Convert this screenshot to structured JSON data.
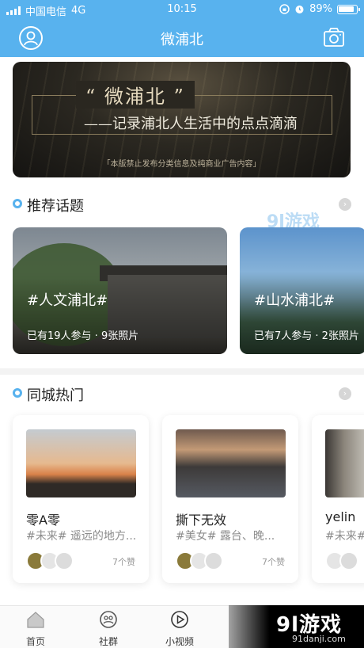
{
  "status_bar": {
    "carrier": "中国电信",
    "network": "4G",
    "time": "10:15",
    "battery": "89%"
  },
  "header": {
    "title": "微浦北"
  },
  "banner": {
    "title": "“ 微浦北 ”",
    "subtitle": "——记录浦北人生活中的点点滴滴",
    "notice": "「本版禁止发布分类信息及纯商业广告内容」"
  },
  "recommended": {
    "heading": "推荐话题",
    "topics": [
      {
        "tag": "#人文浦北#",
        "info": "已有19人参与 · 9张照片"
      },
      {
        "tag": "#山水浦北#",
        "info": "已有7人参与 · 2张照片"
      }
    ]
  },
  "hot": {
    "heading": "同城热门",
    "cards": [
      {
        "name": "零A零",
        "desc": "#未来# 遥远的地方...",
        "likes": "7个赞",
        "avatar_colors": [
          "#8a7a3a",
          "#e5e5e5",
          "#dcdcdc"
        ]
      },
      {
        "name": "撕下无效",
        "desc": "#美女# 露台、晚...",
        "likes": "7个赞",
        "avatar_colors": [
          "#8a7a3a",
          "#e5e5e5",
          "#dcdcdc"
        ]
      },
      {
        "name": "yelin",
        "desc": "#未来# 遥...",
        "likes": "",
        "avatar_colors": [
          "#e5e5e5",
          "#dcdcdc"
        ]
      }
    ]
  },
  "watermark": {
    "brand": "9l游戏",
    "domain": "91danji.com"
  },
  "tabbar": {
    "items": [
      {
        "label": "首页",
        "icon": "home-icon"
      },
      {
        "label": "社群",
        "icon": "community-icon"
      },
      {
        "label": "小视频",
        "icon": "play-icon"
      }
    ]
  },
  "colors": {
    "accent": "#58b2ee"
  }
}
